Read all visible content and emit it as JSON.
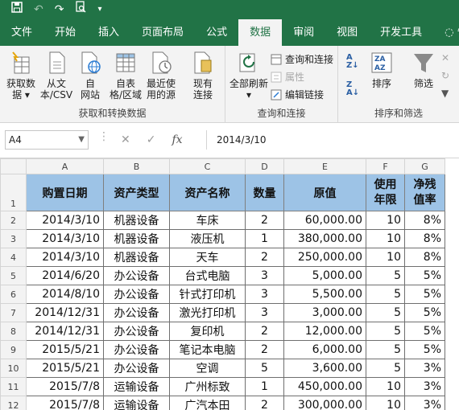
{
  "quick_access": {
    "save_icon": "save-icon",
    "undo_icon": "undo-icon",
    "redo_icon": "redo-icon",
    "print_preview_icon": "print-preview-icon",
    "customize_icon": "customize-qat-icon"
  },
  "tabs": [
    "文件",
    "开始",
    "插入",
    "页面布局",
    "公式",
    "数据",
    "审阅",
    "视图",
    "开发工具"
  ],
  "active_tab": "数据",
  "tell_me": "告诉",
  "ribbon": {
    "get_data": {
      "label": "获取和转换数据",
      "get_data_btn": [
        "获取数",
        "据 ▾"
      ],
      "from_text_btn": [
        "从文",
        "本/CSV"
      ],
      "from_web_btn": [
        "自",
        "网站"
      ],
      "from_table_btn": [
        "自表",
        "格/区域"
      ],
      "recent_sources_btn": [
        "最近使",
        "用的源"
      ],
      "existing_conn_btn": [
        "现有",
        "连接"
      ]
    },
    "queries": {
      "label": "查询和连接",
      "refresh_all_btn": [
        "全部刷新",
        "▾"
      ],
      "queries_conn": "查询和连接",
      "properties": "属性",
      "edit_links": "编辑链接"
    },
    "sort_filter": {
      "label": "排序和筛选",
      "sort_btn": "排序",
      "filter_btn": "筛选"
    }
  },
  "formula_bar": {
    "name_box": "A4",
    "cancel": "✕",
    "enter": "✓",
    "fx": "fx",
    "value": "2014/3/10"
  },
  "columns": [
    "A",
    "B",
    "C",
    "D",
    "E",
    "F",
    "G"
  ],
  "header_row": {
    "row_num": "1",
    "cells": [
      "购置日期",
      "资产类型",
      "资产名称",
      "数量",
      "原值",
      "使用\n年限",
      "净残\n值率"
    ]
  },
  "rows": [
    {
      "n": "2",
      "date": "2014/3/10",
      "type": "机器设备",
      "name": "车床",
      "qty": "2",
      "value": "60,000.00",
      "years": "10",
      "rate": "8%"
    },
    {
      "n": "3",
      "date": "2014/3/10",
      "type": "机器设备",
      "name": "液压机",
      "qty": "1",
      "value": "380,000.00",
      "years": "10",
      "rate": "8%"
    },
    {
      "n": "4",
      "date": "2014/3/10",
      "type": "机器设备",
      "name": "天车",
      "qty": "2",
      "value": "250,000.00",
      "years": "10",
      "rate": "8%"
    },
    {
      "n": "5",
      "date": "2014/6/20",
      "type": "办公设备",
      "name": "台式电脑",
      "qty": "3",
      "value": "5,000.00",
      "years": "5",
      "rate": "5%"
    },
    {
      "n": "6",
      "date": "2014/8/10",
      "type": "办公设备",
      "name": "针式打印机",
      "qty": "3",
      "value": "5,500.00",
      "years": "5",
      "rate": "5%"
    },
    {
      "n": "7",
      "date": "2014/12/31",
      "type": "办公设备",
      "name": "激光打印机",
      "qty": "3",
      "value": "3,000.00",
      "years": "5",
      "rate": "5%"
    },
    {
      "n": "8",
      "date": "2014/12/31",
      "type": "办公设备",
      "name": "复印机",
      "qty": "2",
      "value": "12,000.00",
      "years": "5",
      "rate": "5%"
    },
    {
      "n": "9",
      "date": "2015/5/21",
      "type": "办公设备",
      "name": "笔记本电脑",
      "qty": "2",
      "value": "6,000.00",
      "years": "5",
      "rate": "5%"
    },
    {
      "n": "10",
      "date": "2015/5/21",
      "type": "办公设备",
      "name": "空调",
      "qty": "5",
      "value": "3,600.00",
      "years": "5",
      "rate": "3%"
    },
    {
      "n": "11",
      "date": "2015/7/8",
      "type": "运输设备",
      "name": "广州标致",
      "qty": "1",
      "value": "450,000.00",
      "years": "10",
      "rate": "3%"
    },
    {
      "n": "12",
      "date": "2015/7/8",
      "type": "运输设备",
      "name": "广汽本田",
      "qty": "2",
      "value": "300,000.00",
      "years": "10",
      "rate": "3%"
    }
  ],
  "colors": {
    "excel_green": "#217346",
    "header_fill": "#9dc3e6"
  }
}
